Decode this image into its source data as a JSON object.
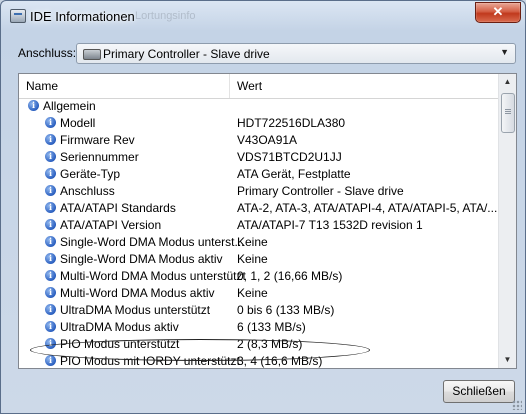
{
  "window": {
    "title": "IDE Informationen",
    "background_title": "Lortungsinfo",
    "close_glyph": "✕"
  },
  "selector": {
    "label": "Anschluss:",
    "value": "Primary Controller - Slave drive",
    "arrow": "▼",
    "icon": "drive-icon"
  },
  "list": {
    "columns": [
      "Name",
      "Wert"
    ],
    "group": "Allgemein",
    "rows": [
      {
        "name": "Modell",
        "value": "HDT722516DLA380"
      },
      {
        "name": "Firmware Rev",
        "value": "V43OA91A"
      },
      {
        "name": "Seriennummer",
        "value": "VDS71BTCD2U1JJ"
      },
      {
        "name": "Geräte-Typ",
        "value": "ATA Gerät, Festplatte"
      },
      {
        "name": "Anschluss",
        "value": "Primary Controller - Slave drive"
      },
      {
        "name": "ATA/ATAPI Standards",
        "value": "ATA-2, ATA-3, ATA/ATAPI-4, ATA/ATAPI-5, ATA/..."
      },
      {
        "name": "ATA/ATAPI Version",
        "value": "ATA/ATAPI-7 T13 1532D revision 1"
      },
      {
        "name": "Single-Word DMA Modus unterst...",
        "value": "Keine"
      },
      {
        "name": "Single-Word DMA Modus aktiv",
        "value": "Keine"
      },
      {
        "name": "Multi-Word DMA Modus unterstützt",
        "value": "0, 1, 2 (16,66 MB/s)"
      },
      {
        "name": "Multi-Word DMA Modus aktiv",
        "value": "Keine"
      },
      {
        "name": "UltraDMA Modus unterstützt",
        "value": "0 bis 6 (133 MB/s)"
      },
      {
        "name": "UltraDMA Modus aktiv",
        "value": "6 (133 MB/s)"
      },
      {
        "name": "PIO Modus unterstützt",
        "value": "2 (8,3 MB/s)"
      },
      {
        "name": "PIO Modus mit IORDY unterstützt",
        "value": "3, 4 (16,6 MB/s)"
      }
    ],
    "info_icon_glyph": "i",
    "scroll_up": "▲",
    "scroll_down": "▼"
  },
  "footer": {
    "close_label": "Schließen"
  },
  "colors": {
    "info_icon": "#2a5fc0",
    "close_button": "#c0391d"
  }
}
